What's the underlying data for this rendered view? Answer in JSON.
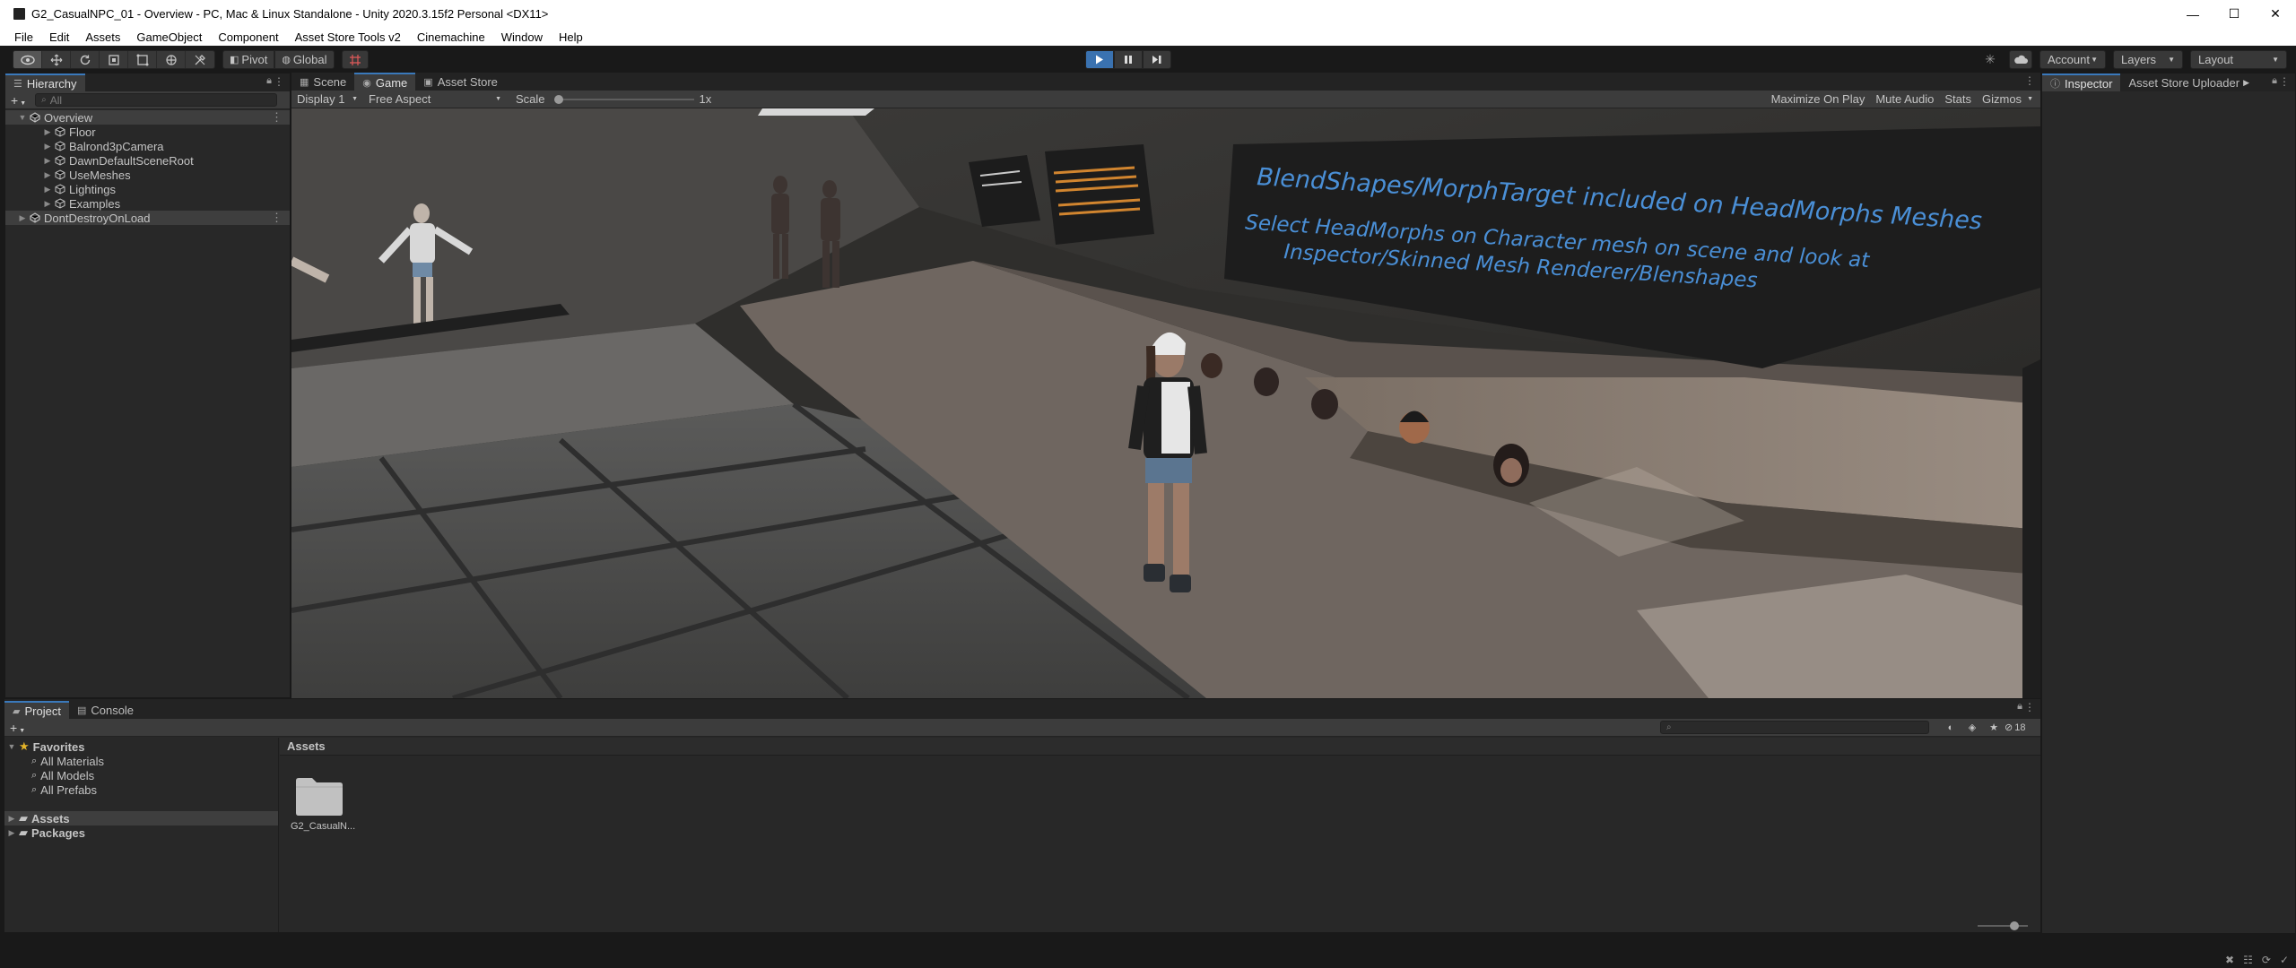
{
  "window": {
    "title": "G2_CasualNPC_01 - Overview - PC, Mac & Linux Standalone - Unity 2020.3.15f2 Personal <DX11>",
    "controls": [
      "—",
      "☐",
      "✕"
    ]
  },
  "menu": [
    "File",
    "Edit",
    "Assets",
    "GameObject",
    "Component",
    "Asset Store Tools v2",
    "Cinemachine",
    "Window",
    "Help"
  ],
  "toolbar": {
    "pivot_label": "Pivot",
    "global_label": "Global",
    "account_label": "Account",
    "layers_label": "Layers",
    "layout_label": "Layout"
  },
  "hierarchy": {
    "tab_label": "Hierarchy",
    "search_placeholder": "All",
    "items": [
      {
        "label": "Overview"
      },
      {
        "label": "Floor"
      },
      {
        "label": "Balrond3pCamera"
      },
      {
        "label": "DawnDefaultSceneRoot"
      },
      {
        "label": "UseMeshes"
      },
      {
        "label": "Lightings"
      },
      {
        "label": "Examples"
      },
      {
        "label": "DontDestroyOnLoad"
      }
    ]
  },
  "center_tabs": {
    "scene": "Scene",
    "game": "Game",
    "asset_store": "Asset Store"
  },
  "game_toolbar": {
    "display": "Display 1",
    "aspect": "Free Aspect",
    "scale_label": "Scale",
    "scale_value": "1x",
    "maximize": "Maximize On Play",
    "mute": "Mute Audio",
    "stats": "Stats",
    "gizmos": "Gizmos"
  },
  "scene_poster": {
    "line1": "BlendShapes/MorphTarget included on HeadMorphs Meshes",
    "line2": "Select HeadMorphs on Character mesh on scene and look at",
    "line3": "Inspector/Skinned Mesh Renderer/Blenshapes"
  },
  "inspector": {
    "tab_label": "Inspector",
    "uploader_label": "Asset Store Uploader"
  },
  "project": {
    "tab_project": "Project",
    "tab_console": "Console",
    "hidden_count": "18",
    "favorites_label": "Favorites",
    "favorites": [
      "All Materials",
      "All Models",
      "All Prefabs"
    ],
    "roots": [
      "Assets",
      "Packages"
    ],
    "breadcrumb": "Assets",
    "assets": [
      {
        "name": "G2_CasualN..."
      }
    ]
  }
}
